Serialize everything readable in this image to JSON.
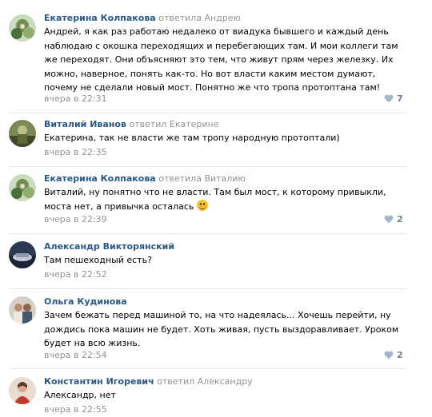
{
  "comments": [
    {
      "author": "Екатерина Колпакова",
      "reply_word": "ответила",
      "reply_to": "Андрею",
      "text": "Андрей, я как раз работаю недалеко от виадука бывшего и каждый день\nнаблюдаю с окошка переходящих и перебегающих там. И мои коллеги там\nже переходят. Они объясняют это тем, что живут прям через железку. Их\nможно, наверное, понять как-то. Но вот власти каким местом думают,\nпочему не сделали новый мост. Понятно же что тропа протоптана там!",
      "time": "вчера в 22:31",
      "likes": "7"
    },
    {
      "author": "Виталий Иванов",
      "reply_word": "ответил",
      "reply_to": "Екатерине",
      "text": "Екатерина, так не власти же там тропу народную протоптали)",
      "time": "вчера в 22:35",
      "likes": ""
    },
    {
      "author": "Екатерина Колпакова",
      "reply_word": "ответила",
      "reply_to": "Виталию",
      "text_line1": "Виталий, ну понятно что не власти. Там был мост, к которому привыкли,",
      "text_line2": "моста нет, а привычка осталась",
      "emoji": "smile",
      "time": "вчера в 22:39",
      "likes": "2"
    },
    {
      "author": "Александр Викторянский",
      "reply_word": "",
      "reply_to": "",
      "text": "Там пешеходный есть?",
      "time": "вчера в 22:52",
      "likes": ""
    },
    {
      "author": "Ольга Кудинова",
      "reply_word": "",
      "reply_to": "",
      "text": "Зачем бежать перед машиной то, на что надеялась... Хочешь перейти, ну\nдождись пока машин не будет. Хоть живая, пусть выздоравливает. Уроком\nбудет на всю жизнь.",
      "time": "вчера в 22:54",
      "likes": "2"
    },
    {
      "author": "Константин Игоревич",
      "reply_word": "ответил",
      "reply_to": "Александру",
      "text": "Александр, нет",
      "time": "вчера в 22:55",
      "likes": ""
    }
  ],
  "colors": {
    "author": "#2a5885",
    "meta": "#939393",
    "like": "#6d7f97",
    "divider": "#e7e8ec"
  },
  "icons": {
    "like": "heart-icon"
  }
}
